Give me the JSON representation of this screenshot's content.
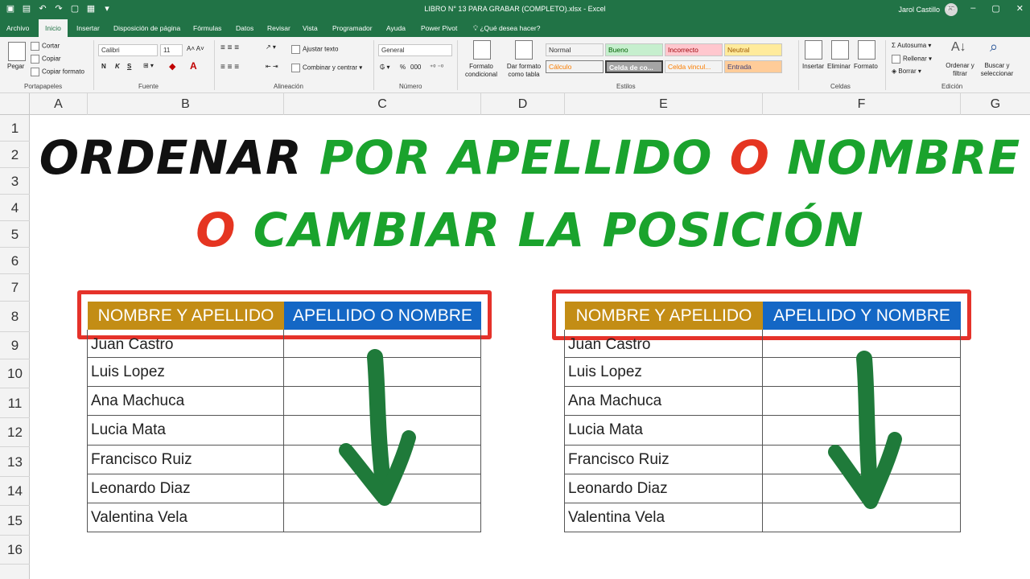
{
  "titlebar": {
    "document_title": "LIBRO N° 13 PARA GRABAR  (COMPLETO).xlsx  -  Excel",
    "user_name": "Jarol Castillo",
    "user_initials": "JC"
  },
  "tabs": [
    {
      "label": "Archivo"
    },
    {
      "label": "Inicio"
    },
    {
      "label": "Insertar"
    },
    {
      "label": "Disposición de página"
    },
    {
      "label": "Fórmulas"
    },
    {
      "label": "Datos"
    },
    {
      "label": "Revisar"
    },
    {
      "label": "Vista"
    },
    {
      "label": "Programador"
    },
    {
      "label": "Ayuda"
    },
    {
      "label": "Power Pivot"
    }
  ],
  "tell_me": "¿Qué desea hacer?",
  "ribbon": {
    "clipboard": {
      "paste": "Pegar",
      "cut": "Cortar",
      "copy": "Copiar",
      "format_painter": "Copiar formato",
      "group": "Portapapeles"
    },
    "font": {
      "name": "Calibri",
      "size": "11",
      "bold": "N",
      "italic": "K",
      "underline": "S",
      "group": "Fuente"
    },
    "alignment": {
      "wrap": "Ajustar texto",
      "merge": "Combinar y centrar",
      "group": "Alineación"
    },
    "number": {
      "format": "General",
      "percent": "%",
      "thousands": "000",
      "group": "Número"
    },
    "styles": {
      "conditional": "Formato condicional",
      "as_table": "Dar formato como tabla",
      "cells": [
        {
          "label": "Normal",
          "bg": "#ffffff",
          "color": "#000000"
        },
        {
          "label": "Bueno",
          "bg": "#c6efce",
          "color": "#006100"
        },
        {
          "label": "Incorrecto",
          "bg": "#ffc7ce",
          "color": "#9c0006"
        },
        {
          "label": "Neutral",
          "bg": "#ffeb9c",
          "color": "#9c5700"
        },
        {
          "label": "Cálculo",
          "bg": "#f2f2f2",
          "color": "#fa7d00"
        },
        {
          "label": "Celda de co...",
          "bg": "#a5a5a5",
          "color": "#ffffff"
        },
        {
          "label": "Celda vincul...",
          "bg": "#ffffff",
          "color": "#fa7d00"
        },
        {
          "label": "Entrada",
          "bg": "#ffcc99",
          "color": "#3f3f76"
        }
      ],
      "group": "Estilos"
    },
    "cells": {
      "insert": "Insertar",
      "delete": "Eliminar",
      "format": "Formato",
      "group": "Celdas"
    },
    "editing": {
      "autosum": "Autosuma",
      "fill": "Rellenar",
      "clear": "Borrar",
      "sort": "Ordenar y filtrar",
      "find": "Buscar y seleccionar",
      "group": "Edición"
    }
  },
  "columns": [
    "A",
    "B",
    "C",
    "D",
    "E",
    "F",
    "G"
  ],
  "rows": [
    "1",
    "2",
    "3",
    "4",
    "5",
    "6",
    "7",
    "8",
    "9",
    "10",
    "11",
    "12",
    "13",
    "14",
    "15",
    "16"
  ],
  "headline": {
    "line1": [
      {
        "text": "ORDENAR ",
        "color": "black"
      },
      {
        "text": "POR APELLIDO ",
        "color": "green"
      },
      {
        "text": "O ",
        "color": "red"
      },
      {
        "text": "NOMBRE",
        "color": "green"
      }
    ],
    "line2": [
      {
        "text": "O ",
        "color": "red"
      },
      {
        "text": "CAMBIAR LA POSICIÓN",
        "color": "green"
      }
    ]
  },
  "table_left": {
    "header_1": "NOMBRE Y APELLIDO",
    "header_2": "APELLIDO O NOMBRE",
    "names": [
      "Juan Castro",
      "Luis Lopez",
      "Ana Machuca",
      "Lucia Mata",
      "Francisco Ruiz",
      "Leonardo Diaz",
      "Valentina Vela"
    ]
  },
  "table_right": {
    "header_1": "NOMBRE Y APELLIDO",
    "header_2": "APELLIDO Y NOMBRE",
    "names": [
      "Juan Castro",
      "Luis Lopez",
      "Ana Machuca",
      "Lucia Mata",
      "Francisco Ruiz",
      "Leonardo Diaz",
      "Valentina Vela"
    ]
  },
  "colors": {
    "excel_green": "#217346",
    "header_gold": "#c38d15",
    "header_blue": "#1467c5",
    "highlight_red": "#e5322a",
    "arrow_green": "#1f7a3a"
  }
}
